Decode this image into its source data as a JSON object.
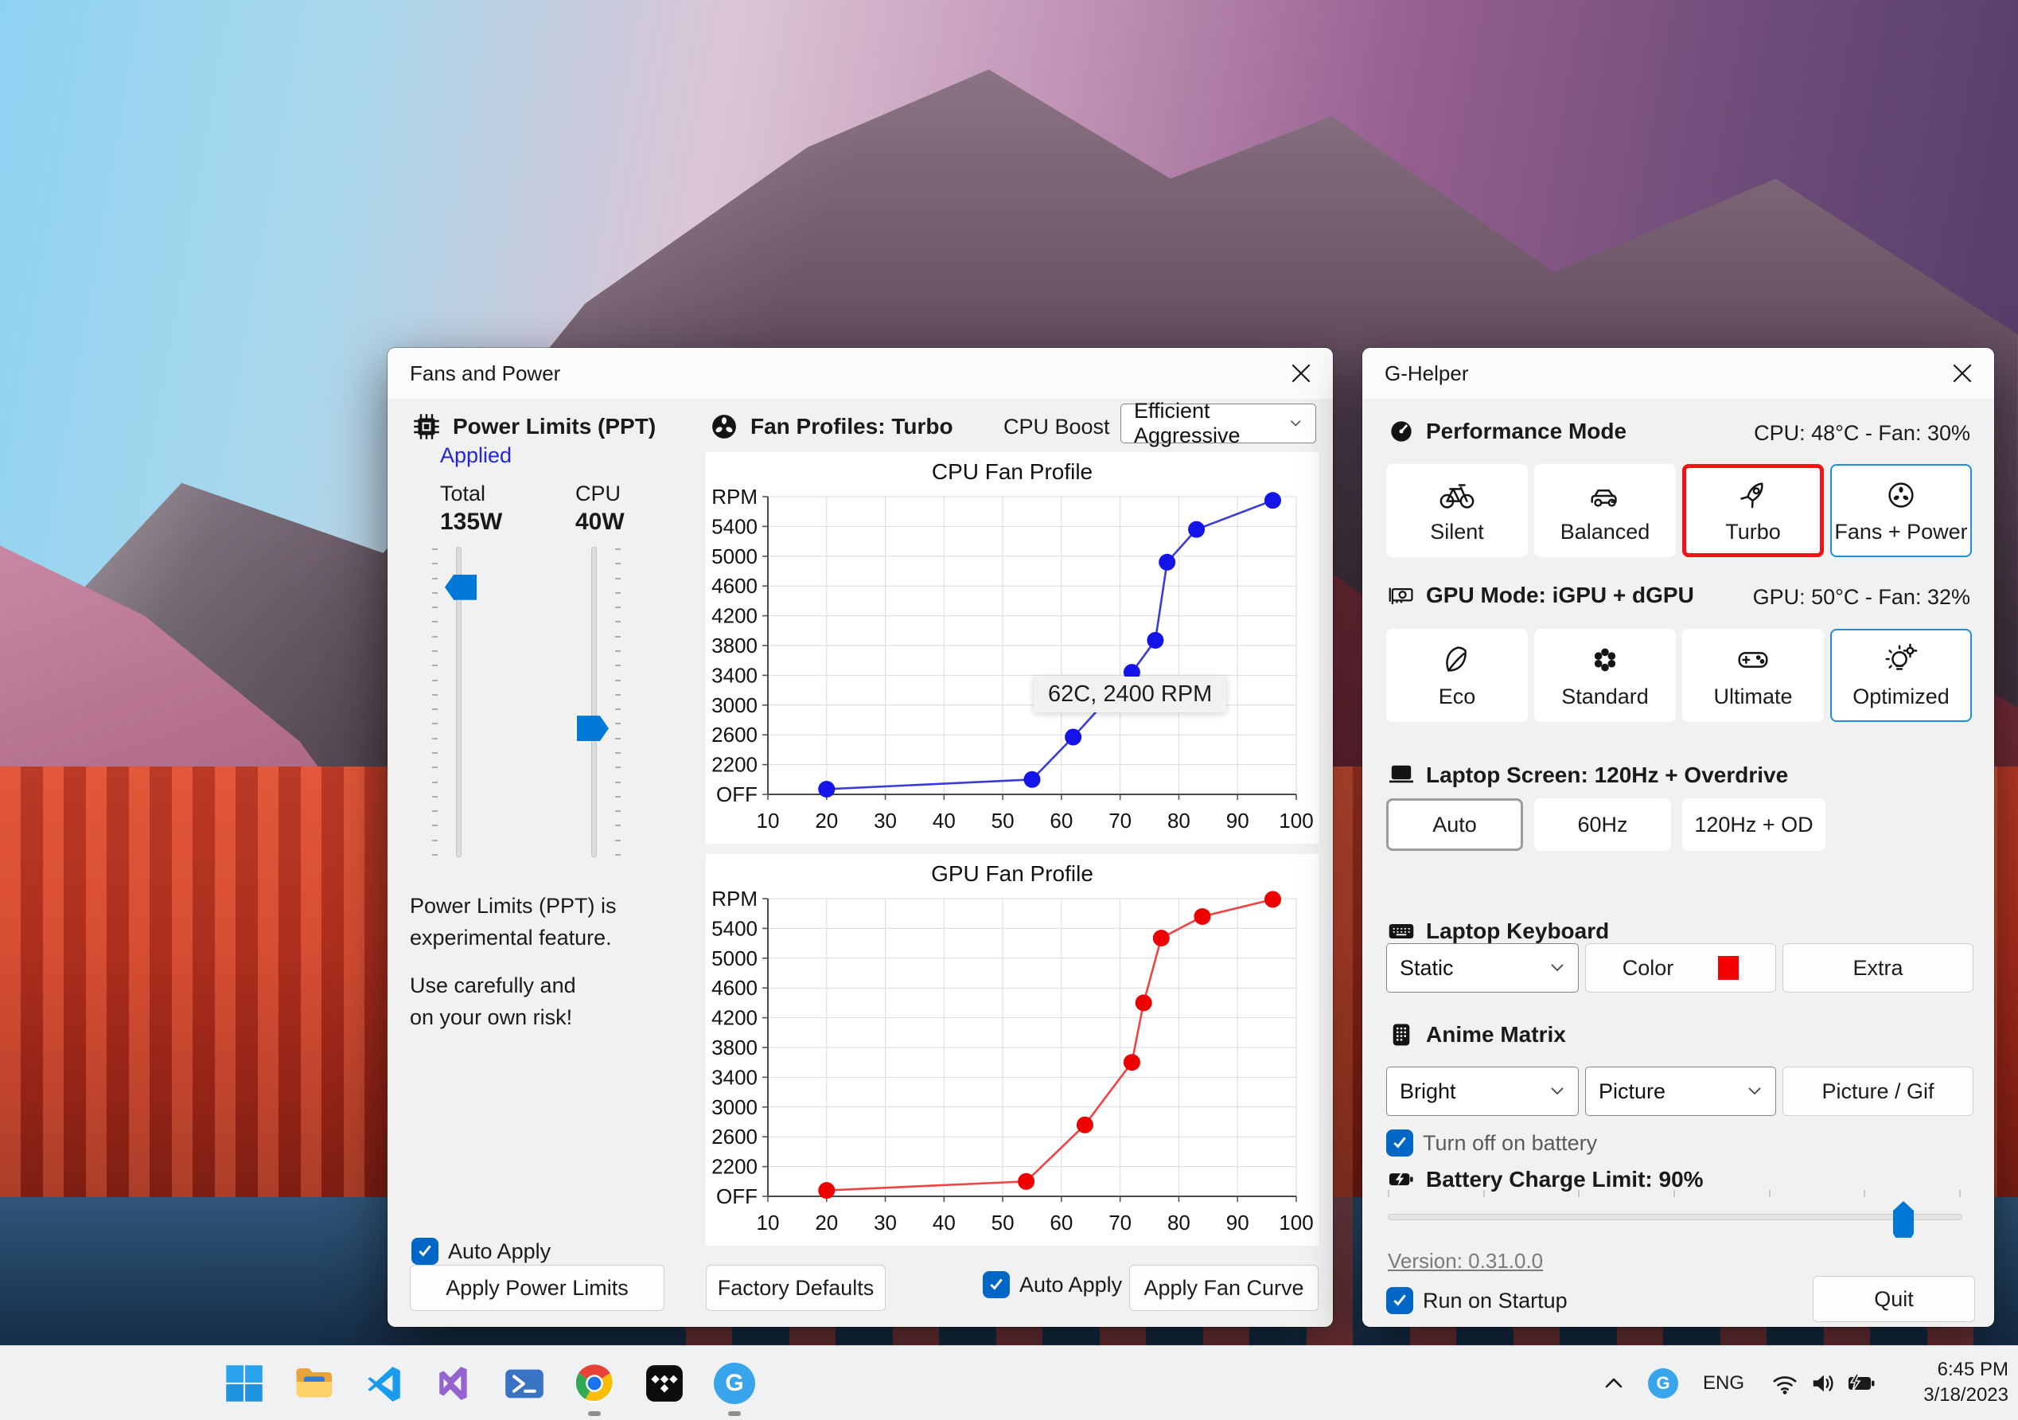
{
  "fans_window": {
    "title": "Fans and Power",
    "power_limits": {
      "header": "Power Limits (PPT)",
      "status": "Applied",
      "total_label": "Total",
      "total_value": "135W",
      "cpu_label": "CPU",
      "cpu_value": "40W",
      "note_line1": "Power Limits (PPT) is",
      "note_line2": "experimental feature.",
      "note_line3": "Use carefully and",
      "note_line4": "on your own risk!",
      "auto_apply_label": "Auto Apply",
      "apply_button": "Apply Power Limits"
    },
    "fan_profiles": {
      "header": "Fan Profiles: Turbo",
      "cpu_boost_label": "CPU Boost",
      "cpu_boost_value": "Efficient Aggressive",
      "factory_defaults_button": "Factory Defaults",
      "auto_apply_label": "Auto Apply",
      "apply_button": "Apply Fan Curve"
    }
  },
  "sliders": {
    "total_percent": 13,
    "cpu_percent": 58.5,
    "battery_percent": 90
  },
  "chart_data": [
    {
      "type": "line",
      "title": "CPU Fan Profile",
      "x_ticks": [
        10,
        20,
        30,
        40,
        50,
        60,
        70,
        80,
        90,
        100
      ],
      "y_tick_labels": [
        "RPM",
        "5400",
        "5000",
        "4600",
        "4200",
        "3800",
        "3400",
        "3000",
        "2600",
        "2200",
        "OFF"
      ],
      "y_top_value": 5800,
      "y_bottom_value": 1800,
      "x_range": [
        10,
        100
      ],
      "grid": true,
      "points": [
        [
          20,
          1870
        ],
        [
          55,
          2000
        ],
        [
          62,
          2570
        ],
        [
          72,
          3440
        ],
        [
          76,
          3870
        ],
        [
          78,
          4920
        ],
        [
          83,
          5360
        ],
        [
          96,
          5750
        ]
      ],
      "line_color": "#3b3bd8",
      "point_color": "#1414e8",
      "tooltip": {
        "text": "62C, 2400 RPM"
      }
    },
    {
      "type": "line",
      "title": "GPU Fan Profile",
      "x_ticks": [
        10,
        20,
        30,
        40,
        50,
        60,
        70,
        80,
        90,
        100
      ],
      "y_tick_labels": [
        "RPM",
        "5400",
        "5000",
        "4600",
        "4200",
        "3800",
        "3400",
        "3000",
        "2600",
        "2200",
        "OFF"
      ],
      "y_top_value": 5800,
      "y_bottom_value": 1800,
      "x_range": [
        10,
        100
      ],
      "grid": true,
      "points": [
        [
          20,
          1880
        ],
        [
          54,
          2000
        ],
        [
          64,
          2760
        ],
        [
          72,
          3600
        ],
        [
          74,
          4400
        ],
        [
          77,
          5270
        ],
        [
          84,
          5560
        ],
        [
          96,
          5790
        ]
      ],
      "line_color": "#ef4444",
      "point_color": "#ee0000",
      "tooltip": null
    }
  ],
  "ghelper": {
    "title": "G-Helper",
    "performance": {
      "header": "Performance Mode",
      "temps": "CPU: 48°C -  Fan: 30%",
      "buttons": [
        {
          "label": "Silent"
        },
        {
          "label": "Balanced"
        },
        {
          "label": "Turbo"
        },
        {
          "label": "Fans + Power"
        }
      ]
    },
    "gpu": {
      "header": "GPU Mode: iGPU + dGPU",
      "temps": "GPU: 50°C -  Fan: 32%",
      "buttons": [
        {
          "label": "Eco"
        },
        {
          "label": "Standard"
        },
        {
          "label": "Ultimate"
        },
        {
          "label": "Optimized"
        }
      ]
    },
    "screen": {
      "header": "Laptop Screen: 120Hz + Overdrive",
      "buttons": [
        {
          "label": "Auto"
        },
        {
          "label": "60Hz"
        },
        {
          "label": "120Hz + OD"
        }
      ]
    },
    "keyboard": {
      "header": "Laptop Keyboard",
      "mode_value": "Static",
      "color_button": "Color",
      "extra_button": "Extra",
      "swatch_color": "#f50000"
    },
    "anime": {
      "header": "Anime Matrix",
      "brightness_value": "Bright",
      "mode_value": "Picture",
      "picture_button": "Picture / Gif",
      "battery_checkbox": "Turn off on battery"
    },
    "battery": {
      "header": "Battery Charge Limit: 90%",
      "version_link": "Version: 0.31.0.0"
    },
    "footer": {
      "run_on_startup": "Run on Startup",
      "quit_button": "Quit"
    }
  },
  "taskbar": {
    "tray": {
      "language": "ENG",
      "time": "6:45 PM",
      "date": "3/18/2023",
      "ghelper_letter": "G"
    },
    "app_icons": [
      "start",
      "file-explorer",
      "vscode",
      "visual-studio",
      "powershell",
      "chrome",
      "tidal",
      "g-helper"
    ],
    "ghelper_letter": "G"
  },
  "colors": {
    "accent_blue": "#0078D7",
    "checkbox_blue": "#0067C6",
    "selected_red_border": "#f01414",
    "selected_blue_border": "#1b8ede",
    "applied_text": "#2424e0"
  }
}
